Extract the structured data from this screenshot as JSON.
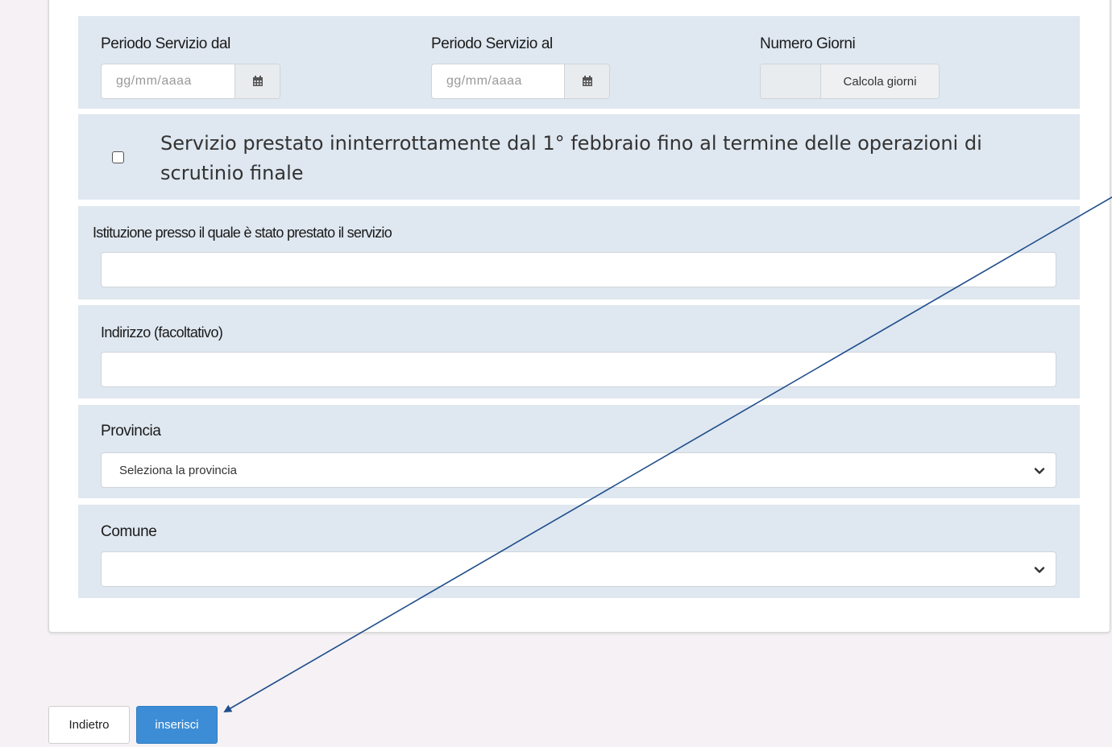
{
  "periodo": {
    "dal_label": "Periodo Servizio dal",
    "al_label": "Periodo Servizio al",
    "giorni_label": "Numero Giorni",
    "dal_placeholder": "gg/mm/aaaa",
    "al_placeholder": "gg/mm/aaaa",
    "calcola_label": "Calcola giorni",
    "calendar_icon": "calendar-icon"
  },
  "continuativo": {
    "label": "Servizio prestato ininterrottamente dal 1° febbraio fino al termine delle operazioni di scrutinio finale",
    "checked": false
  },
  "istituzione": {
    "label": "Istituzione presso il quale è stato prestato il servizio",
    "value": ""
  },
  "indirizzo": {
    "label": "Indirizzo (facoltativo)",
    "value": ""
  },
  "provincia": {
    "label": "Provincia",
    "selected": "Seleziona la provincia"
  },
  "comune": {
    "label": "Comune",
    "selected": ""
  },
  "actions": {
    "back_label": "Indietro",
    "insert_label": "inserisci"
  },
  "colors": {
    "band": "#dfe7f0",
    "primary": "#3d8dd6",
    "arrow": "#1f4e8c",
    "page_bg": "#f5f1f4"
  }
}
